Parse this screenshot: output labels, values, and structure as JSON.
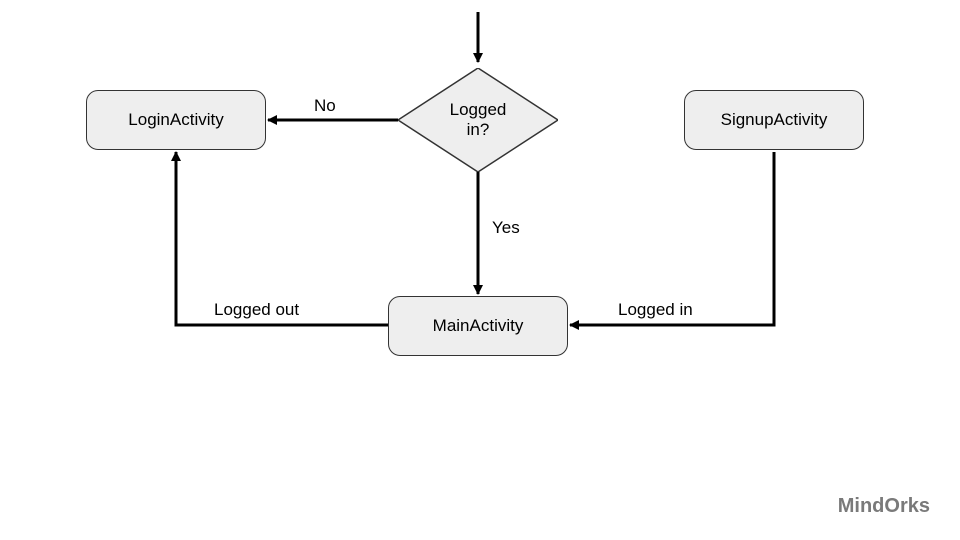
{
  "nodes": {
    "login": {
      "label": "LoginActivity"
    },
    "signup": {
      "label": "SignupActivity"
    },
    "main": {
      "label": "MainActivity"
    },
    "decision": {
      "label": "Logged\nin?"
    }
  },
  "edges": {
    "entry_to_decision": {},
    "decision_no": {
      "label": "No"
    },
    "decision_yes": {
      "label": "Yes"
    },
    "main_loggedout": {
      "label": "Logged out"
    },
    "signup_loggedin": {
      "label": "Logged in"
    }
  },
  "attribution": {
    "text": "MindOrks"
  },
  "colors": {
    "nodeFill": "#eeeeee",
    "stroke": "#333333",
    "bg": "#ffffff",
    "attribution": "#7a7a7a"
  }
}
